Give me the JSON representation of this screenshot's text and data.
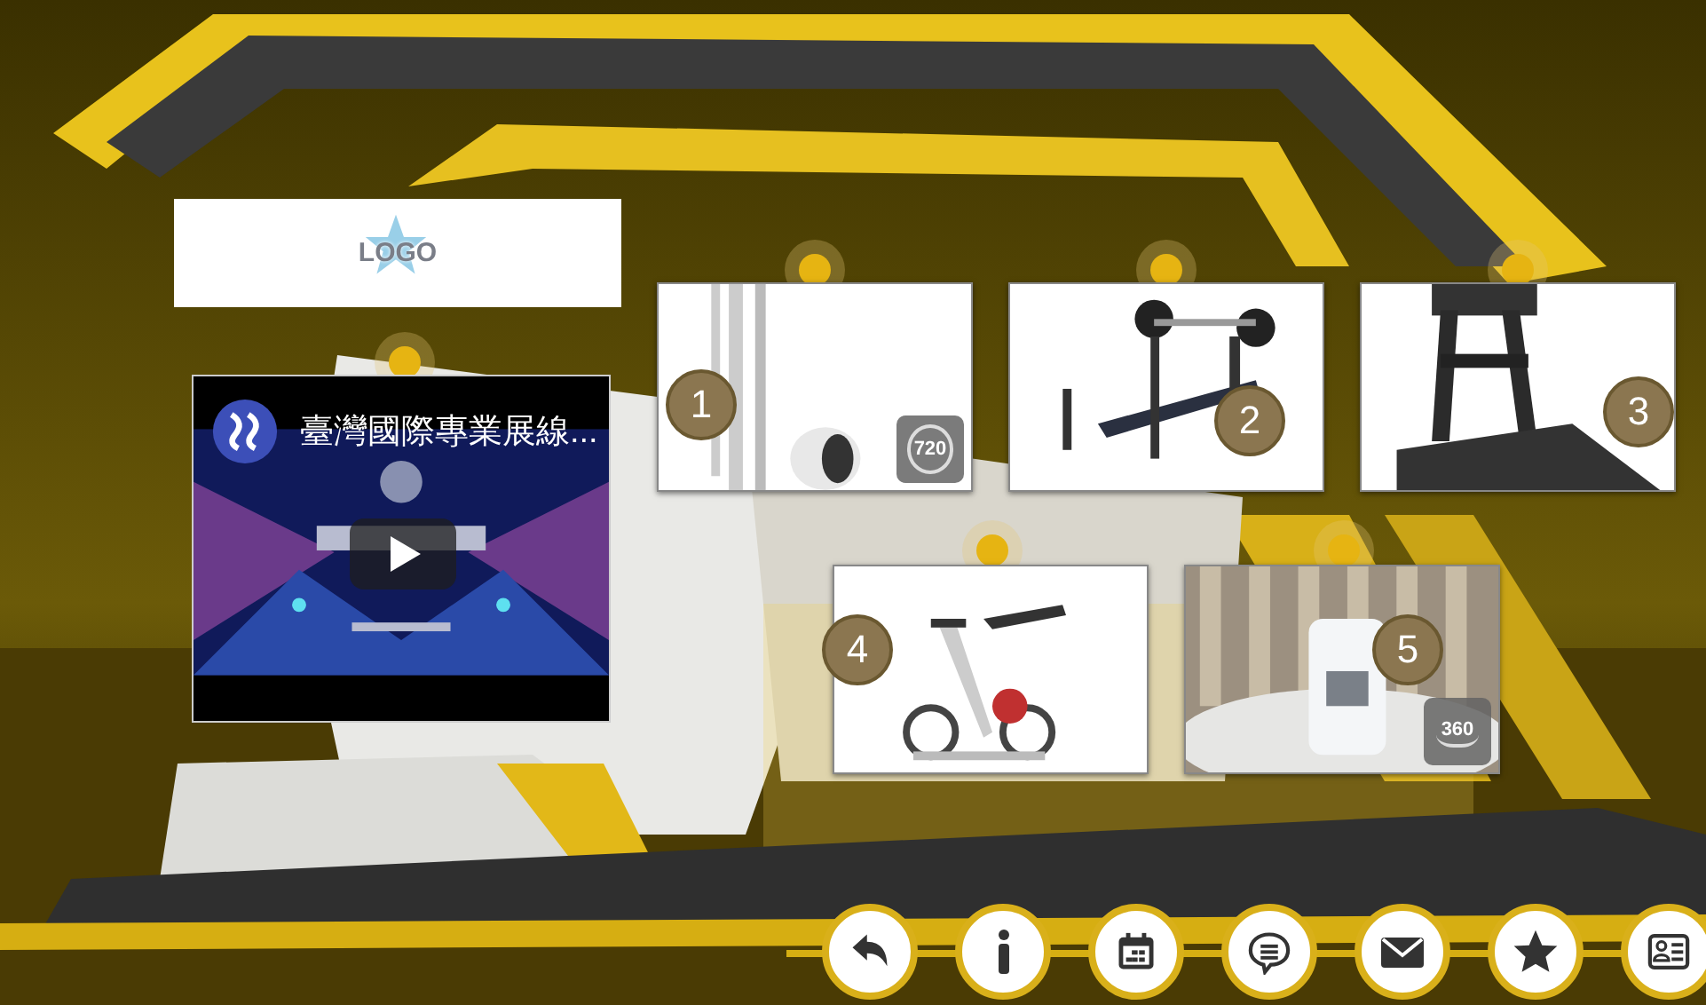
{
  "logo": {
    "text": "LOGO"
  },
  "video": {
    "title": "臺灣國際專業展線..."
  },
  "products": [
    {
      "number": "1",
      "view_badge": "720"
    },
    {
      "number": "2"
    },
    {
      "number": "3"
    },
    {
      "number": "4"
    },
    {
      "number": "5",
      "view_badge": "360"
    }
  ],
  "toolbar": [
    {
      "kind": "back"
    },
    {
      "kind": "info"
    },
    {
      "kind": "calendar"
    },
    {
      "kind": "chat"
    },
    {
      "kind": "mail"
    },
    {
      "kind": "star"
    },
    {
      "kind": "contact"
    }
  ]
}
